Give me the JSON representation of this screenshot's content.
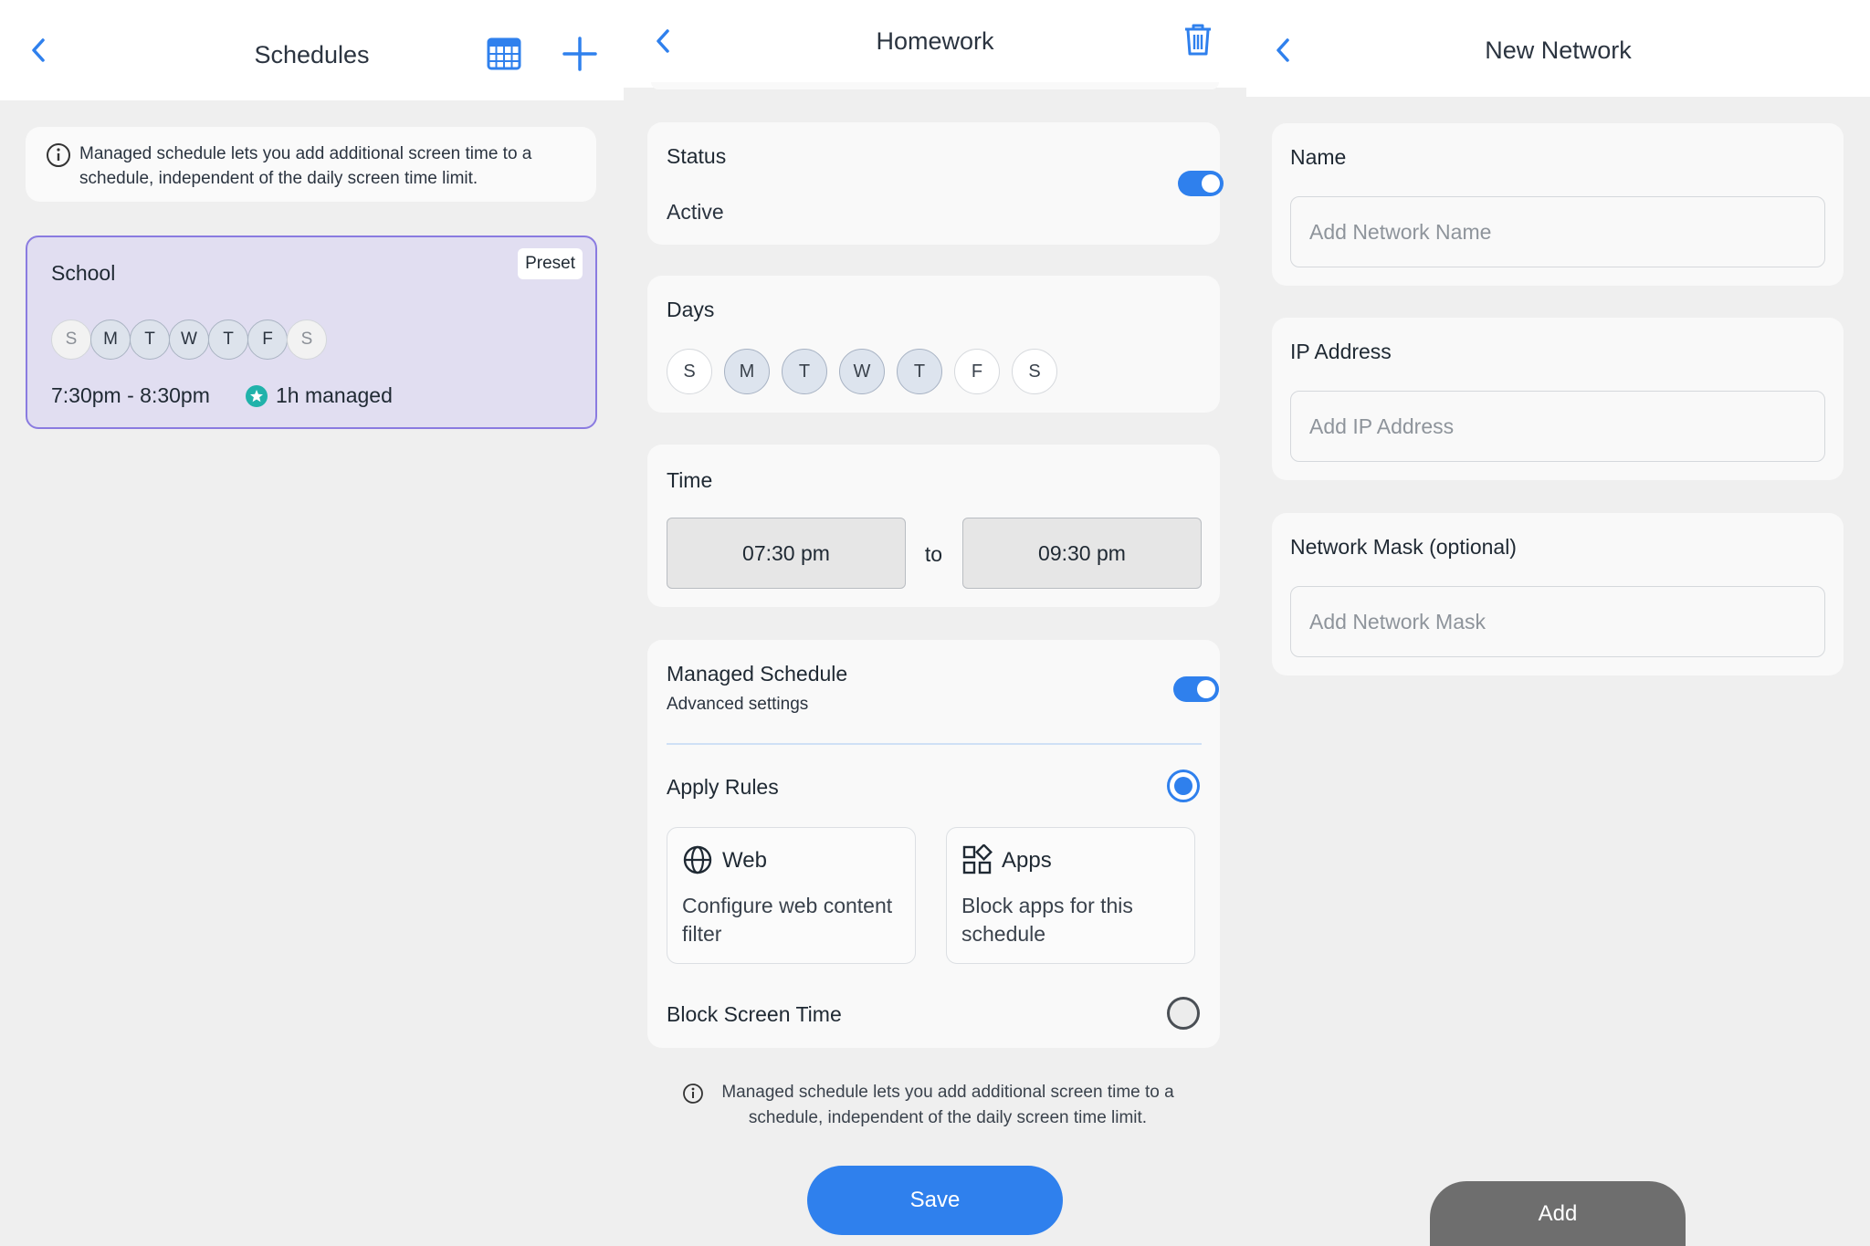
{
  "schedules": {
    "title": "Schedules",
    "info": "Managed schedule lets you add additional screen time to a schedule, independent of the daily screen time limit.",
    "card": {
      "name": "School",
      "badge": "Preset",
      "days": [
        "S",
        "M",
        "T",
        "W",
        "T",
        "F",
        "S"
      ],
      "active_days": [
        false,
        true,
        true,
        true,
        true,
        true,
        false
      ],
      "time": "7:30pm - 8:30pm",
      "managed": "1h managed"
    }
  },
  "homework": {
    "title": "Homework",
    "status_label": "Status",
    "status_value": "Active",
    "days_label": "Days",
    "days": [
      "S",
      "M",
      "T",
      "W",
      "T",
      "F",
      "S"
    ],
    "active_days": [
      false,
      true,
      true,
      true,
      true,
      false,
      false
    ],
    "time_label": "Time",
    "time_from": "07:30 pm",
    "time_to_word": "to",
    "time_to": "09:30 pm",
    "managed_label": "Managed Schedule",
    "managed_sub": "Advanced settings",
    "apply_rules": "Apply Rules",
    "web_title": "Web",
    "web_desc": "Configure web content filter",
    "apps_title": "Apps",
    "apps_desc": "Block apps for this schedule",
    "block_screen_time": "Block Screen Time",
    "info": "Managed schedule lets you add additional screen time to a schedule, independent of the daily screen time limit.",
    "save": "Save"
  },
  "network": {
    "title": "New Network",
    "name_label": "Name",
    "name_placeholder": "Add Network Name",
    "ip_label": "IP Address",
    "ip_placeholder": "Add IP Address",
    "mask_label": "Network Mask (optional)",
    "mask_placeholder": "Add Network Mask",
    "add": "Add"
  },
  "colors": {
    "accent": "#2f80ed",
    "preset_card_bg": "#e1def1",
    "preset_card_border": "#8a7be0",
    "managed_star": "#20b2aa",
    "add_button": "#6e6e6e"
  }
}
